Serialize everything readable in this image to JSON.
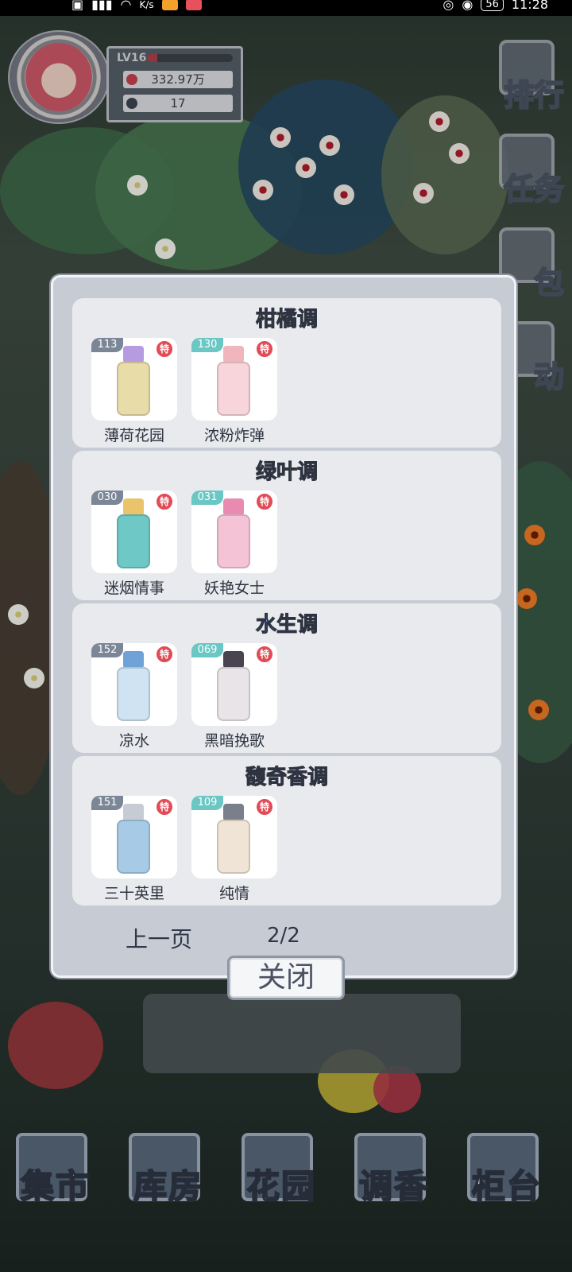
{
  "status_bar": {
    "left_icons": [
      "hd-icon",
      "signal-icon",
      "wifi-icon"
    ],
    "net_speed_unit": "K/s",
    "battery": "56",
    "time": "11:28"
  },
  "player": {
    "level": "LV16",
    "exp_progress": 0.12,
    "money": "332.97万",
    "leaves": "17"
  },
  "side_menu": [
    "排行",
    "任务",
    "包",
    "动"
  ],
  "modal": {
    "sections": [
      {
        "title": "柑橘调",
        "title_color": "#e9b25c",
        "items": [
          {
            "num": "113",
            "badge": "特",
            "name": "薄荷花园",
            "tag_color": "#7b8697"
          },
          {
            "num": "130",
            "badge": "特",
            "name": "浓粉炸弹",
            "tag_color": "#6ac7c3"
          }
        ]
      },
      {
        "title": "绿叶调",
        "title_color": "#8ec87a",
        "items": [
          {
            "num": "030",
            "badge": "特",
            "name": "迷烟情事",
            "tag_color": "#7b8697"
          },
          {
            "num": "031",
            "badge": "特",
            "name": "妖艳女士",
            "tag_color": "#6ac7c3"
          }
        ]
      },
      {
        "title": "水生调",
        "title_color": "#5b8fe0",
        "items": [
          {
            "num": "152",
            "badge": "特",
            "name": "凉水",
            "tag_color": "#7b8697"
          },
          {
            "num": "069",
            "badge": "特",
            "name": "黑暗挽歌",
            "tag_color": "#6ac7c3"
          }
        ]
      },
      {
        "title": "馥奇香调",
        "title_color": "#7b6de0",
        "items": [
          {
            "num": "151",
            "badge": "特",
            "name": "三十英里",
            "tag_color": "#7b8697"
          },
          {
            "num": "109",
            "badge": "特",
            "name": "纯情",
            "tag_color": "#6ac7c3"
          }
        ]
      }
    ],
    "prev_label": "上一页",
    "page": "2/2",
    "close_label": "关闭"
  },
  "bottom_nav": [
    "集市",
    "库房",
    "花园",
    "调香",
    "柜台"
  ]
}
